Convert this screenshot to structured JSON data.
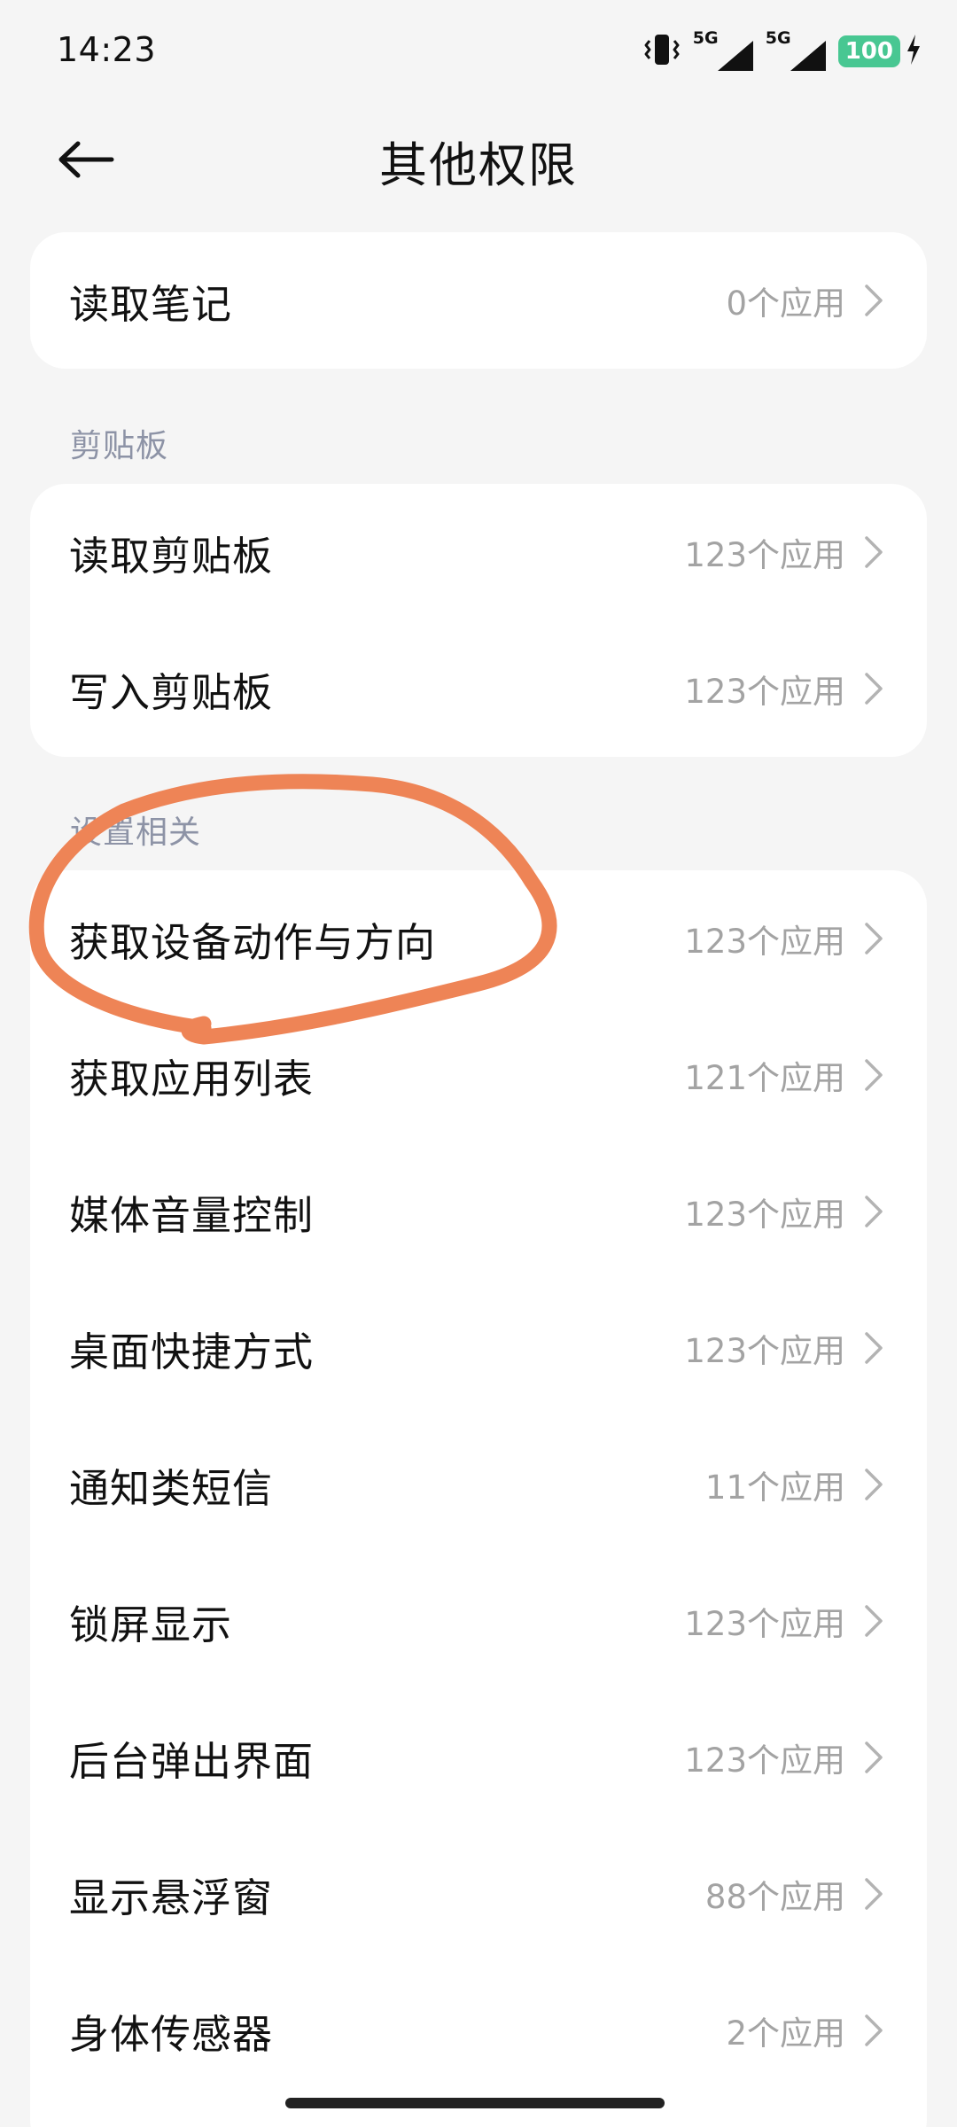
{
  "status": {
    "time": "14:23",
    "signal1_label": "5G",
    "signal2_label": "5G",
    "battery": "100"
  },
  "header": {
    "title": "其他权限"
  },
  "top_card": {
    "items": [
      {
        "label": "读取笔记",
        "value": "0个应用"
      }
    ]
  },
  "clipboard": {
    "section_title": "剪贴板",
    "items": [
      {
        "label": "读取剪贴板",
        "value": "123个应用"
      },
      {
        "label": "写入剪贴板",
        "value": "123个应用"
      }
    ]
  },
  "settings": {
    "section_title": "设置相关",
    "items": [
      {
        "label": "获取设备动作与方向",
        "value": "123个应用"
      },
      {
        "label": "获取应用列表",
        "value": "121个应用"
      },
      {
        "label": "媒体音量控制",
        "value": "123个应用"
      },
      {
        "label": "桌面快捷方式",
        "value": "123个应用"
      },
      {
        "label": "通知类短信",
        "value": "11个应用"
      },
      {
        "label": "锁屏显示",
        "value": "123个应用"
      },
      {
        "label": "后台弹出界面",
        "value": "123个应用"
      },
      {
        "label": "显示悬浮窗",
        "value": "88个应用"
      },
      {
        "label": "身体传感器",
        "value": "2个应用"
      }
    ]
  },
  "colors": {
    "annotation": "#ee8456",
    "battery": "#48c792",
    "section_title": "#8d93a6",
    "secondary_text": "#a3a3a3"
  },
  "icons": {
    "back": "arrow-left-icon",
    "chevron": "chevron-right-icon",
    "vibrate": "vibrate-icon",
    "signal": "signal-icon",
    "charging": "lightning-icon"
  }
}
